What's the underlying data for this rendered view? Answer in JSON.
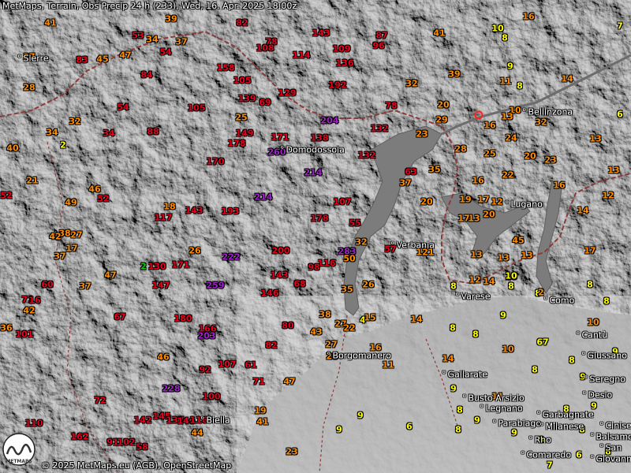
{
  "title": "MetMaps, Terrain, Obs Precip 24 h (233), Wed, 16. Apr. 2025 18:00z",
  "copyright": "© 2025 MetMaps.eu (AGB), OpenStreetMap",
  "logo_text": "METMAPS",
  "colors": {
    "yellow": "#ffff00",
    "orange": "#ff8c00",
    "red": "#e8001c",
    "purple": "#a020c8",
    "green": "#00d000",
    "terrain_dark": "#2a2a2a",
    "plain": "#9a9a9a",
    "lake": "#7a7a7a",
    "border": "#8b3a3a",
    "marker": "#ff2020"
  },
  "cities": [
    {
      "name": "Sierre"
    },
    {
      "name": "Bellinzona"
    },
    {
      "name": "Domodossola"
    },
    {
      "name": "Lugano"
    },
    {
      "name": "Verbania"
    },
    {
      "name": "Varese"
    },
    {
      "name": "Como"
    },
    {
      "name": "Cantù"
    },
    {
      "name": "Giussano"
    },
    {
      "name": "Seregno"
    },
    {
      "name": "Desio"
    },
    {
      "name": "Borgomanero"
    },
    {
      "name": "Gallarate"
    },
    {
      "name": "Busto Arsizio"
    },
    {
      "name": "Legnano"
    },
    {
      "name": "Garbagnate"
    },
    {
      "name": "Cinisello"
    },
    {
      "name": "Balsamo"
    },
    {
      "name": "San"
    },
    {
      "name": "Giovanni"
    },
    {
      "name": "Parabiago"
    },
    {
      "name": "Milanese"
    },
    {
      "name": "Rho"
    },
    {
      "name": "Comaredo"
    },
    {
      "name": "Biella"
    }
  ],
  "observations": [
    {
      "v": "41",
      "c": "orange"
    },
    {
      "v": "39",
      "c": "orange"
    },
    {
      "v": "82",
      "c": "red"
    },
    {
      "v": "53",
      "c": "red"
    },
    {
      "v": "34",
      "c": "orange"
    },
    {
      "v": "37",
      "c": "orange"
    },
    {
      "v": "78",
      "c": "red"
    },
    {
      "v": "108",
      "c": "red"
    },
    {
      "v": "143",
      "c": "red"
    },
    {
      "v": "109",
      "c": "red"
    },
    {
      "v": "87",
      "c": "red"
    },
    {
      "v": "96",
      "c": "red"
    },
    {
      "v": "41",
      "c": "orange"
    },
    {
      "v": "16",
      "c": "orange"
    },
    {
      "v": "10",
      "c": "yellow"
    },
    {
      "v": "8",
      "c": "yellow"
    },
    {
      "v": "7",
      "c": "yellow"
    },
    {
      "v": "27",
      "c": "orange"
    },
    {
      "v": "83",
      "c": "red"
    },
    {
      "v": "45",
      "c": "orange"
    },
    {
      "v": "47",
      "c": "orange"
    },
    {
      "v": "54",
      "c": "red"
    },
    {
      "v": "114",
      "c": "red"
    },
    {
      "v": "136",
      "c": "red"
    },
    {
      "v": "158",
      "c": "red"
    },
    {
      "v": "84",
      "c": "red"
    },
    {
      "v": "105",
      "c": "red"
    },
    {
      "v": "192",
      "c": "red"
    },
    {
      "v": "32",
      "c": "orange"
    },
    {
      "v": "39",
      "c": "orange"
    },
    {
      "v": "9",
      "c": "yellow"
    },
    {
      "v": "11",
      "c": "orange"
    },
    {
      "v": "8",
      "c": "yellow"
    },
    {
      "v": "14",
      "c": "orange"
    },
    {
      "v": "28",
      "c": "orange"
    },
    {
      "v": "139",
      "c": "red"
    },
    {
      "v": "69",
      "c": "red"
    },
    {
      "v": "129",
      "c": "red"
    },
    {
      "v": "78",
      "c": "red"
    },
    {
      "v": "20",
      "c": "orange"
    },
    {
      "v": "105",
      "c": "red"
    },
    {
      "v": "54",
      "c": "red"
    },
    {
      "v": "25",
      "c": "orange"
    },
    {
      "v": "32",
      "c": "orange"
    },
    {
      "v": "204",
      "c": "purple"
    },
    {
      "v": "29",
      "c": "orange"
    },
    {
      "v": "10",
      "c": "orange"
    },
    {
      "v": "16",
      "c": "orange"
    },
    {
      "v": "13",
      "c": "orange"
    },
    {
      "v": "32",
      "c": "orange"
    },
    {
      "v": "6",
      "c": "yellow"
    },
    {
      "v": "34",
      "c": "orange"
    },
    {
      "v": "88",
      "c": "red"
    },
    {
      "v": "149",
      "c": "red"
    },
    {
      "v": "138",
      "c": "red"
    },
    {
      "v": "132",
      "c": "red"
    },
    {
      "v": "23",
      "c": "orange"
    },
    {
      "v": "34",
      "c": "red"
    },
    {
      "v": "2",
      "c": "yellow"
    },
    {
      "v": "40",
      "c": "orange"
    },
    {
      "v": "178",
      "c": "red"
    },
    {
      "v": "171",
      "c": "red"
    },
    {
      "v": "260",
      "c": "purple"
    },
    {
      "v": "132",
      "c": "red"
    },
    {
      "v": "28",
      "c": "orange"
    },
    {
      "v": "25",
      "c": "orange"
    },
    {
      "v": "24",
      "c": "orange"
    },
    {
      "v": "13",
      "c": "orange"
    },
    {
      "v": "20",
      "c": "orange"
    },
    {
      "v": "23",
      "c": "orange"
    },
    {
      "v": "170",
      "c": "red"
    },
    {
      "v": "214",
      "c": "purple"
    },
    {
      "v": "63",
      "c": "red"
    },
    {
      "v": "35",
      "c": "orange"
    },
    {
      "v": "22",
      "c": "orange"
    },
    {
      "v": "16",
      "c": "orange"
    },
    {
      "v": "21",
      "c": "orange"
    },
    {
      "v": "46",
      "c": "orange"
    },
    {
      "v": "37",
      "c": "orange"
    },
    {
      "v": "16",
      "c": "orange"
    },
    {
      "v": "13",
      "c": "orange"
    },
    {
      "v": "52",
      "c": "red"
    },
    {
      "v": "52",
      "c": "red"
    },
    {
      "v": "49",
      "c": "orange"
    },
    {
      "v": "214",
      "c": "purple"
    },
    {
      "v": "20",
      "c": "orange"
    },
    {
      "v": "19",
      "c": "orange"
    },
    {
      "v": "17",
      "c": "orange"
    },
    {
      "v": "12",
      "c": "orange"
    },
    {
      "v": "12",
      "c": "orange"
    },
    {
      "v": "18",
      "c": "orange"
    },
    {
      "v": "143",
      "c": "red"
    },
    {
      "v": "193",
      "c": "red"
    },
    {
      "v": "107",
      "c": "red"
    },
    {
      "v": "14",
      "c": "orange"
    },
    {
      "v": "117",
      "c": "red"
    },
    {
      "v": "13",
      "c": "orange"
    },
    {
      "v": "178",
      "c": "red"
    },
    {
      "v": "55",
      "c": "red"
    },
    {
      "v": "20",
      "c": "orange"
    },
    {
      "v": "17",
      "c": "orange"
    },
    {
      "v": "38",
      "c": "orange"
    },
    {
      "v": "27",
      "c": "orange"
    },
    {
      "v": "42",
      "c": "orange"
    },
    {
      "v": "32",
      "c": "orange"
    },
    {
      "v": "45",
      "c": "orange"
    },
    {
      "v": "17",
      "c": "orange"
    },
    {
      "v": "26",
      "c": "orange"
    },
    {
      "v": "200",
      "c": "red"
    },
    {
      "v": "283",
      "c": "purple"
    },
    {
      "v": "57",
      "c": "red"
    },
    {
      "v": "121",
      "c": "orange"
    },
    {
      "v": "13",
      "c": "orange"
    },
    {
      "v": "13",
      "c": "orange"
    },
    {
      "v": "13",
      "c": "orange"
    },
    {
      "v": "17",
      "c": "orange"
    },
    {
      "v": "37",
      "c": "orange"
    },
    {
      "v": "2",
      "c": "green"
    },
    {
      "v": "130",
      "c": "red"
    },
    {
      "v": "171",
      "c": "red"
    },
    {
      "v": "222",
      "c": "purple"
    },
    {
      "v": "116",
      "c": "red"
    },
    {
      "v": "98",
      "c": "red"
    },
    {
      "v": "50",
      "c": "orange"
    },
    {
      "v": "10",
      "c": "orange"
    },
    {
      "v": "47",
      "c": "orange"
    },
    {
      "v": "143",
      "c": "red"
    },
    {
      "v": "12",
      "c": "orange"
    },
    {
      "v": "14",
      "c": "orange"
    },
    {
      "v": "10",
      "c": "yellow"
    },
    {
      "v": "8",
      "c": "yellow"
    },
    {
      "v": "60",
      "c": "red"
    },
    {
      "v": "37",
      "c": "orange"
    },
    {
      "v": "147",
      "c": "red"
    },
    {
      "v": "259",
      "c": "purple"
    },
    {
      "v": "68",
      "c": "red"
    },
    {
      "v": "26",
      "c": "orange"
    },
    {
      "v": "8",
      "c": "yellow"
    },
    {
      "v": "8",
      "c": "yellow"
    },
    {
      "v": "2",
      "c": "orange"
    },
    {
      "v": "8",
      "c": "yellow"
    },
    {
      "v": "71",
      "c": "red"
    },
    {
      "v": "146",
      "c": "red"
    },
    {
      "v": "35",
      "c": "orange"
    },
    {
      "v": "8",
      "c": "yellow"
    },
    {
      "v": "16",
      "c": "red"
    },
    {
      "v": "42",
      "c": "orange"
    },
    {
      "v": "67",
      "c": "red"
    },
    {
      "v": "180",
      "c": "red"
    },
    {
      "v": "38",
      "c": "orange"
    },
    {
      "v": "4",
      "c": "yellow"
    },
    {
      "v": "15",
      "c": "orange"
    },
    {
      "v": "14",
      "c": "orange"
    },
    {
      "v": "9",
      "c": "yellow"
    },
    {
      "v": "10",
      "c": "orange"
    },
    {
      "v": "36",
      "c": "orange"
    },
    {
      "v": "101",
      "c": "red"
    },
    {
      "v": "166",
      "c": "red"
    },
    {
      "v": "80",
      "c": "red"
    },
    {
      "v": "27",
      "c": "orange"
    },
    {
      "v": "22",
      "c": "orange"
    },
    {
      "v": "43",
      "c": "orange"
    },
    {
      "v": "8",
      "c": "yellow"
    },
    {
      "v": "8",
      "c": "yellow"
    },
    {
      "v": "203",
      "c": "purple"
    },
    {
      "v": "27",
      "c": "orange"
    },
    {
      "v": "16",
      "c": "orange"
    },
    {
      "v": "67",
      "c": "yellow"
    },
    {
      "v": "82",
      "c": "red"
    },
    {
      "v": "10",
      "c": "orange"
    },
    {
      "v": "46",
      "c": "orange"
    },
    {
      "v": "28",
      "c": "orange"
    },
    {
      "v": "14",
      "c": "orange"
    },
    {
      "v": "8",
      "c": "yellow"
    },
    {
      "v": "9",
      "c": "yellow"
    },
    {
      "v": "107",
      "c": "red"
    },
    {
      "v": "61",
      "c": "red"
    },
    {
      "v": "11",
      "c": "orange"
    },
    {
      "v": "92",
      "c": "red"
    },
    {
      "v": "8",
      "c": "yellow"
    },
    {
      "v": "9",
      "c": "yellow"
    },
    {
      "v": "71",
      "c": "red"
    },
    {
      "v": "47",
      "c": "orange"
    },
    {
      "v": "9",
      "c": "yellow"
    },
    {
      "v": "228",
      "c": "purple"
    },
    {
      "v": "72",
      "c": "red"
    },
    {
      "v": "100",
      "c": "red"
    },
    {
      "v": "11",
      "c": "orange"
    },
    {
      "v": "8",
      "c": "yellow"
    },
    {
      "v": "9",
      "c": "yellow"
    },
    {
      "v": "8",
      "c": "yellow"
    },
    {
      "v": "19",
      "c": "orange"
    },
    {
      "v": "9",
      "c": "yellow"
    },
    {
      "v": "110",
      "c": "red"
    },
    {
      "v": "142",
      "c": "red"
    },
    {
      "v": "145",
      "c": "red"
    },
    {
      "v": "137",
      "c": "red"
    },
    {
      "v": "146",
      "c": "red"
    },
    {
      "v": "116",
      "c": "red"
    },
    {
      "v": "41",
      "c": "orange"
    },
    {
      "v": "8",
      "c": "yellow"
    },
    {
      "v": "9",
      "c": "yellow"
    },
    {
      "v": "6",
      "c": "yellow"
    },
    {
      "v": "8",
      "c": "yellow"
    },
    {
      "v": "9",
      "c": "yellow"
    },
    {
      "v": "9",
      "c": "yellow"
    },
    {
      "v": "162",
      "c": "red"
    },
    {
      "v": "44",
      "c": "orange"
    },
    {
      "v": "91",
      "c": "red"
    },
    {
      "v": "102",
      "c": "red"
    },
    {
      "v": "58",
      "c": "red"
    },
    {
      "v": "0",
      "c": "yellow"
    },
    {
      "v": "23",
      "c": "orange"
    },
    {
      "v": "6",
      "c": "yellow"
    },
    {
      "v": "8",
      "c": "yellow"
    },
    {
      "v": "7",
      "c": "yellow"
    }
  ]
}
